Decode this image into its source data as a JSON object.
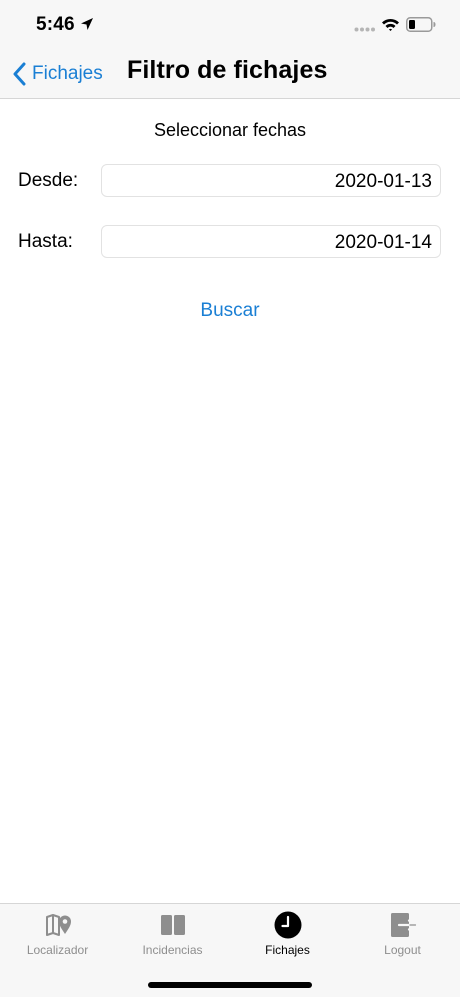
{
  "status_bar": {
    "time": "5:46"
  },
  "nav": {
    "back_label": "Fichajes",
    "title": "Filtro de fichajes"
  },
  "content": {
    "section_title": "Seleccionar fechas",
    "from_label": "Desde:",
    "from_value": "2020-01-13",
    "to_label": "Hasta:",
    "to_value": "2020-01-14",
    "search_label": "Buscar"
  },
  "tabs": [
    {
      "label": "Localizador",
      "icon": "map-pin-icon",
      "active": false
    },
    {
      "label": "Incidencias",
      "icon": "book-icon",
      "active": false
    },
    {
      "label": "Fichajes",
      "icon": "clock-icon",
      "active": true
    },
    {
      "label": "Logout",
      "icon": "logout-icon",
      "active": false
    }
  ],
  "colors": {
    "accent": "#1a7fd4",
    "inactive": "#8e8e8e",
    "bar_background": "#f7f7f7"
  }
}
